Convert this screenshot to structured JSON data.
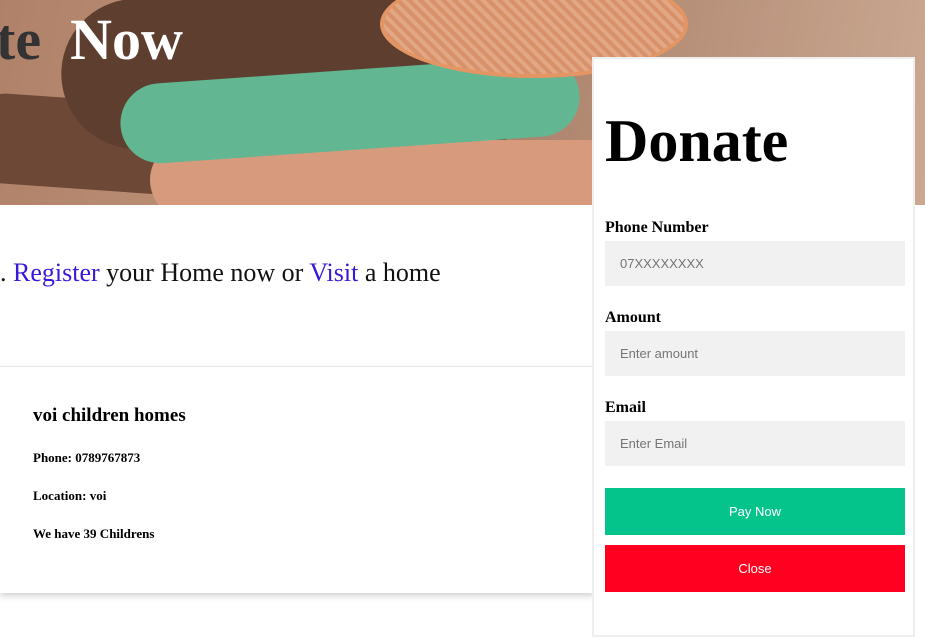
{
  "hero": {
    "title_part1": "te",
    "title_part2": "Now"
  },
  "intro": {
    "prefix": ". ",
    "register_link": "Register",
    "middle": " your Home now or ",
    "visit_link": "Visit",
    "suffix": " a home"
  },
  "home_card": {
    "name": "voi children homes",
    "phone": "Phone: 0789767873",
    "location": "Location: voi",
    "children": "We have 39 Childrens"
  },
  "donate_modal": {
    "title": "Donate",
    "phone_label": "Phone Number",
    "phone_placeholder": "07XXXXXXXX",
    "phone_value": "",
    "amount_label": "Amount",
    "amount_placeholder": "Enter amount",
    "amount_value": "",
    "email_label": "Email",
    "email_placeholder": "Enter Email",
    "email_value": "",
    "pay_button": "Pay Now",
    "close_button": "Close"
  },
  "colors": {
    "link": "#3a18d6",
    "pay_button": "#04c48c",
    "close_button": "#ff0020",
    "input_bg": "#f1f1f1"
  }
}
